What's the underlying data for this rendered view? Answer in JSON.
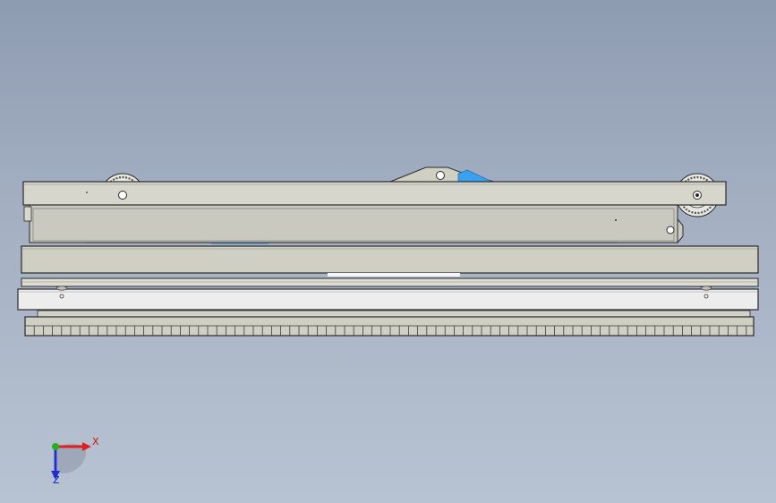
{
  "viewport": {
    "background_top": "#8e9cb2",
    "background_bottom": "#b8c3d2"
  },
  "triad": {
    "x_label": "X",
    "z_label": "Z",
    "x_color": "#e02020",
    "y_color": "#20b020",
    "z_color": "#2030d0"
  },
  "model": {
    "frame_color": "#cfcfc4",
    "edge_color": "#2a2a2a",
    "highlight_color": "#3aa0f0",
    "rail_color": "#ededed"
  }
}
